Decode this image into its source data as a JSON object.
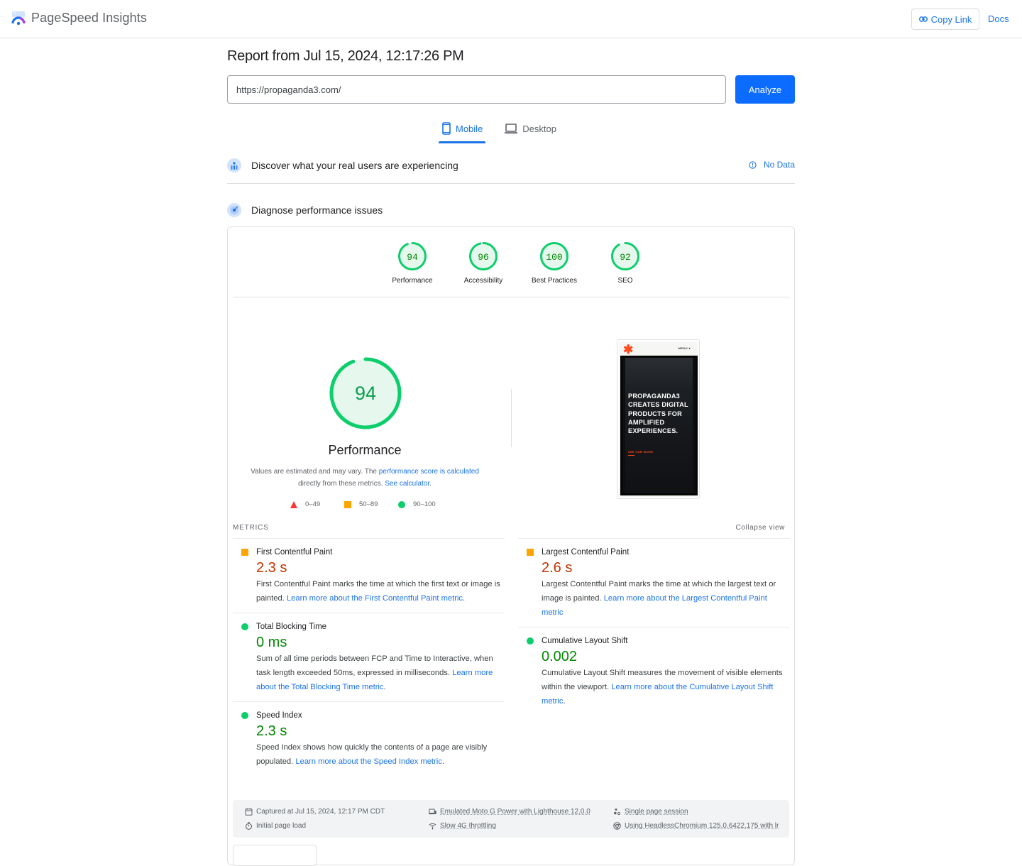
{
  "header": {
    "app_name": "PageSpeed Insights",
    "copy_link_label": "Copy Link",
    "docs_label": "Docs"
  },
  "report": {
    "title": "Report from Jul 15, 2024, 12:17:26 PM",
    "url_value": "https://propaganda3.com/",
    "analyze_label": "Analyze"
  },
  "tabs": [
    {
      "label": "Mobile",
      "icon": "smartphone-icon",
      "active": true
    },
    {
      "label": "Desktop",
      "icon": "laptop-icon",
      "active": false
    }
  ],
  "sections": {
    "field_data_title": "Discover what your real users are experiencing",
    "field_data_status": "No Data",
    "diagnose_title": "Diagnose performance issues"
  },
  "scores": [
    {
      "label": "Performance",
      "value": 94
    },
    {
      "label": "Accessibility",
      "value": 96
    },
    {
      "label": "Best Practices",
      "value": 100
    },
    {
      "label": "SEO",
      "value": 92
    }
  ],
  "performance": {
    "score": 94,
    "label": "Performance",
    "note_prefix": "Values are estimated and may vary. The ",
    "note_link1": "performance score is calculated",
    "note_mid": " directly from these metrics. ",
    "note_link2": "See calculator.",
    "legend": [
      {
        "shape": "triangle",
        "range": "0–49"
      },
      {
        "shape": "square",
        "range": "50–89"
      },
      {
        "shape": "circle",
        "range": "90–100"
      }
    ]
  },
  "screenshot": {
    "menu": "MENU ▾",
    "headline": "PROPAGANDA3 CREATES DIGITAL PRODUCTS FOR AMPLIFIED EXPERIENCES.",
    "cta": "SEE OUR WORK"
  },
  "metrics": {
    "section_label": "METRICS",
    "collapse_label": "Collapse view",
    "left": [
      {
        "name": "First Contentful Paint",
        "value": "2.3 s",
        "rating": "average",
        "desc": "First Contentful Paint marks the time at which the first text or image is painted. ",
        "link": "Learn more about the First Contentful Paint metric",
        "tail": "."
      },
      {
        "name": "Total Blocking Time",
        "value": "0 ms",
        "rating": "pass",
        "desc": "Sum of all time periods between FCP and Time to Interactive, when task length exceeded 50ms, expressed in milliseconds. ",
        "link": "Learn more about the Total Blocking Time metric",
        "tail": "."
      },
      {
        "name": "Speed Index",
        "value": "2.3 s",
        "rating": "pass",
        "desc": "Speed Index shows how quickly the contents of a page are visibly populated. ",
        "link": "Learn more about the Speed Index metric",
        "tail": "."
      }
    ],
    "right": [
      {
        "name": "Largest Contentful Paint",
        "value": "2.6 s",
        "rating": "average",
        "desc": "Largest Contentful Paint marks the time at which the largest text or image is painted. ",
        "link": "Learn more about the Largest Contentful Paint metric",
        "tail": ""
      },
      {
        "name": "Cumulative Layout Shift",
        "value": "0.002",
        "rating": "pass",
        "desc": "Cumulative Layout Shift measures the movement of visible elements within the viewport. ",
        "link": "Learn more about the Cumulative Layout Shift metric",
        "tail": "."
      }
    ]
  },
  "runtime": {
    "captured": "Captured at Jul 15, 2024, 12:17 PM CDT",
    "load_type": "Initial page load",
    "device": "Emulated Moto G Power with Lighthouse 12.0.0",
    "throttling": "Slow 4G throttling",
    "session": "Single page session",
    "browser": "Using HeadlessChromium 125.0.6422.175 with lr"
  },
  "colors": {
    "accent": "#1a73e8",
    "analyze_button": "#0b6cff",
    "pass": "#0cce6b",
    "pass_text": "#008800",
    "average": "#ffa400",
    "average_text": "#c33300",
    "fail": "#ff3333",
    "gauge_fill": "#e6f7ed"
  }
}
